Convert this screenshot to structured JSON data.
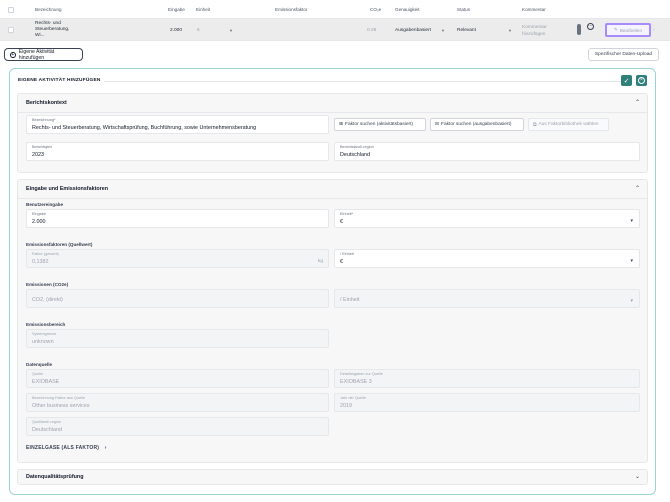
{
  "table": {
    "headers": {
      "bezeichnung": "Bezeichnung",
      "eingabe": "Eingabe",
      "einheit": "Einheit",
      "emissionsfaktor": "Emissionsfaktor",
      "co2": "CO₂e",
      "genauigkeit": "Genauigkeit",
      "status": "Status",
      "kommentar": "Kommentar"
    },
    "row": {
      "bezeichnung_1": "Rechts- und",
      "bezeichnung_2": "Steuerberatung,",
      "bezeichnung_3": "Wi...",
      "eingabe": "2.000",
      "einheit": "€",
      "co2": "0.28",
      "genauigkeit": "Ausgabenbasiert",
      "status": "Relevant",
      "kommentar": "Kommentar hinzufügen",
      "edit_label": "Bearbeiten"
    }
  },
  "toolbar": {
    "add_activity": "Eigene Aktivität hinzufügen",
    "upload": "Spezifischer Daten-Upload"
  },
  "panel": {
    "title": "EIGENE AKTIVITÄT HINZUFÜGEN",
    "berichtskontext": {
      "title": "Berichtskontext",
      "bezeichnung_label": "Bezeichnung*",
      "bezeichnung_value": "Rechts- und Steuerberatung, Wirtschaftsprüfung, Buchführung, sowie Unternehmensberatung",
      "btn_activity": "Faktor suchen (aktivitätsbasiert)",
      "btn_spend": "Faktor suchen (ausgabenbasiert)",
      "btn_library": "Aus Faktorbibliothek wählen",
      "jahr_label": "Berichtsjahr",
      "jahr_value": "2023",
      "land_label": "Berichtsland/-region",
      "land_value": "Deutschland"
    },
    "eingabe": {
      "title": "Eingabe und Emissionsfaktoren",
      "benutzereingabe": "Benutzereingabe",
      "eingabe_label": "Eingabe",
      "eingabe_value": "2.000",
      "einheit_label": "Einheit*",
      "einheit_value": "€",
      "ef_group": "Emissionsfaktoren (Quellwert)",
      "faktor_label": "Faktor (gesamt)",
      "faktor_value": "0,1382",
      "faktor_unit": "kg",
      "per_einheit_label": "/ Einheit",
      "per_einheit_value": "€",
      "em_group": "Emissionen (CO2e)",
      "co2_placeholder": "CO2, (direkt)",
      "per_einheit_placeholder": "/ Einheit",
      "bereich_group": "Emissionsbereich",
      "system_label": "Systemgrenze",
      "system_value": "unknown",
      "quelle_group": "Datenquelle",
      "quelle_label": "Quelle",
      "quelle_value": "EXIOBASE",
      "angaben_label": "Detailangaben zur Quelle",
      "angaben_value": "EXIOBASE 3",
      "bez_quelle_label": "Bezeichnung Faktor aus Quelle",
      "bez_quelle_value": "Other business services",
      "jahr_quelle_label": "Jahr der Quelle",
      "jahr_quelle_value": "2019",
      "land_quelle_label": "Quellland/-region",
      "land_quelle_value": "Deutschland",
      "einzelgase": "EINZELGASE (ALS FAKTOR)"
    },
    "qualitaet": {
      "title": "Datenqualitätsprüfung"
    }
  },
  "colors": {
    "accent": "#2f7f7a",
    "panel_border": "#99d5d3",
    "edit_highlight": "#a78bfa"
  },
  "icons": [
    "check-icon",
    "close-icon",
    "plus-circle-icon",
    "pencil-icon",
    "chevron-up-icon",
    "chevron-down-icon",
    "chevron-right-icon",
    "chart-search-icon",
    "receipt-search-icon",
    "library-icon"
  ]
}
